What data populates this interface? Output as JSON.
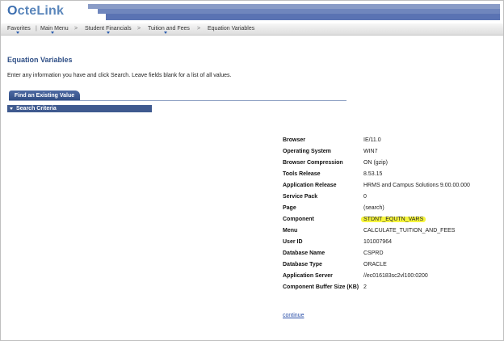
{
  "header": {
    "logo_o": "O",
    "logo_rest": "cte",
    "logo_link": "Link"
  },
  "nav": {
    "items": [
      "Favorites",
      "Main Menu",
      "Student Financials",
      "Tuition and Fees",
      "Equation Variables"
    ],
    "separator": ">",
    "pipe": "|"
  },
  "page": {
    "title": "Equation Variables",
    "instructions": "Enter any information you have and click Search. Leave fields blank for a list of all values.",
    "tab_label": "Find an Existing Value",
    "search_criteria_label": "Search Criteria"
  },
  "info": {
    "rows": [
      {
        "label": "Browser",
        "value": "IE/11.0"
      },
      {
        "label": "Operating System",
        "value": "WIN7"
      },
      {
        "label": "Browser Compression",
        "value": "ON (gzip)"
      },
      {
        "label": "Tools Release",
        "value": "8.53.15"
      },
      {
        "label": "Application Release",
        "value": "HRMS and Campus Solutions 9.00.00.000"
      },
      {
        "label": "Service Pack",
        "value": "0"
      },
      {
        "label": "Page",
        "value": "(search)"
      },
      {
        "label": "Component",
        "value": "STDNT_EQUTN_VARS",
        "highlighted": true
      },
      {
        "label": "Menu",
        "value": "CALCULATE_TUITION_AND_FEES"
      },
      {
        "label": "User ID",
        "value": "101007964"
      },
      {
        "label": "Database Name",
        "value": "CSPRD"
      },
      {
        "label": "Database Type",
        "value": "ORACLE"
      },
      {
        "label": "Application Server",
        "value": "//ec016183sc2vl100:0200"
      },
      {
        "label": "Component Buffer Size (KB)",
        "value": "2"
      }
    ],
    "highlight_color": "#f6f53d"
  },
  "continue_label": "continue"
}
